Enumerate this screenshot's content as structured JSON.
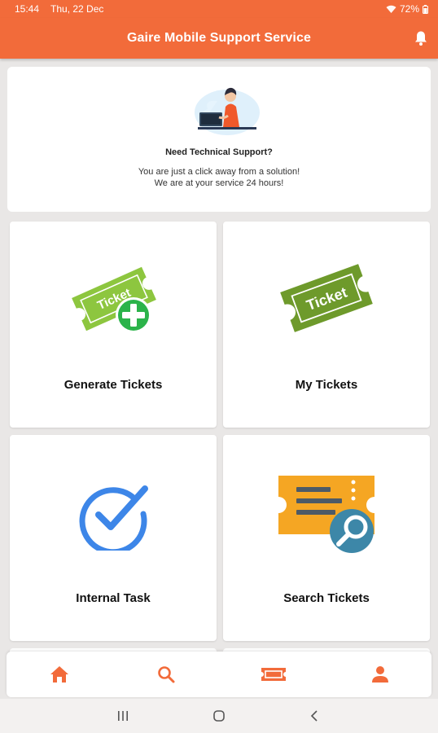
{
  "status_bar": {
    "time": "15:44",
    "date": "Thu, 22 Dec",
    "battery": "72%"
  },
  "app_bar": {
    "title": "Gaire Mobile Support Service",
    "color": "#f26b3a"
  },
  "hero": {
    "heading": "Need Technical Support?",
    "line1": "You are just a click away from a solution!",
    "line2": "We are at your service 24 hours!"
  },
  "tiles": [
    {
      "label": "Generate Tickets",
      "icon": "ticket-plus-icon"
    },
    {
      "label": "My Tickets",
      "icon": "ticket-icon"
    },
    {
      "label": "Internal Task",
      "icon": "check-circle-icon"
    },
    {
      "label": "Search Tickets",
      "icon": "ticket-search-icon"
    }
  ],
  "ticket_text": "Ticket",
  "bottom_nav": {
    "items": [
      "home-icon",
      "search-icon",
      "ticket-icon",
      "person-icon"
    ],
    "active_color": "#f26b3a"
  },
  "system_nav": [
    "recents-icon",
    "home-circle-icon",
    "back-icon"
  ]
}
